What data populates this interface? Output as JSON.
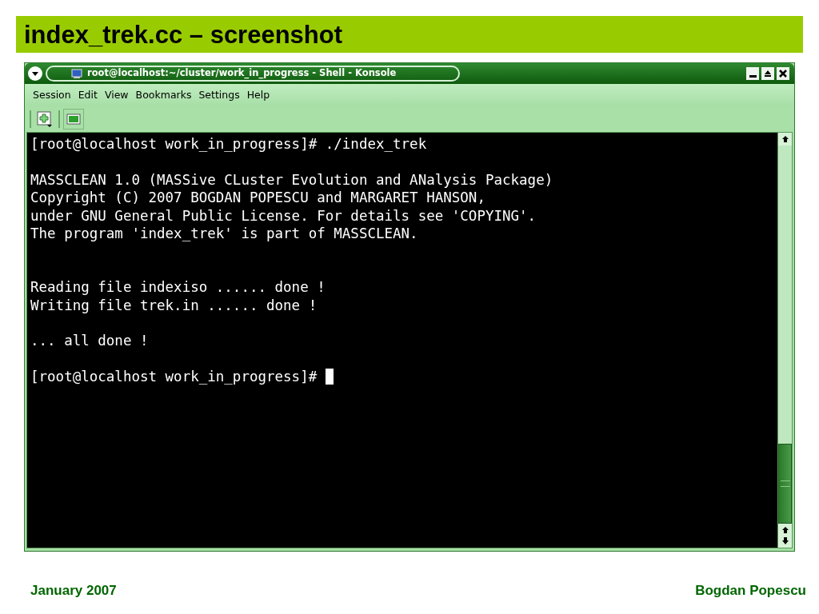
{
  "slide": {
    "title": "index_trek.cc – screenshot",
    "footer_left": "January 2007",
    "footer_right": "Bogdan Popescu"
  },
  "window": {
    "title": "root@localhost:~/cluster/work_in_progress - Shell - Konsole"
  },
  "menu": [
    "Session",
    "Edit",
    "View",
    "Bookmarks",
    "Settings",
    "Help"
  ],
  "terminal": {
    "blocks": [
      {
        "lines": [
          "[root@localhost work_in_progress]# ./index_trek"
        ]
      },
      {
        "lines": [
          "MASSCLEAN 1.0 (MASSive CLuster Evolution and ANalysis Package)",
          "Copyright (C) 2007 BOGDAN POPESCU and MARGARET HANSON,",
          "under GNU General Public License. For details see 'COPYING'.",
          "The program 'index_trek' is part of MASSCLEAN."
        ]
      },
      {
        "lines": [
          "Reading file indexiso ...... done !",
          "Writing file trek.in ...... done !"
        ]
      },
      {
        "lines": [
          "... all done !"
        ]
      },
      {
        "lines": [
          "[root@localhost work_in_progress]# "
        ],
        "cursor": true
      }
    ]
  }
}
